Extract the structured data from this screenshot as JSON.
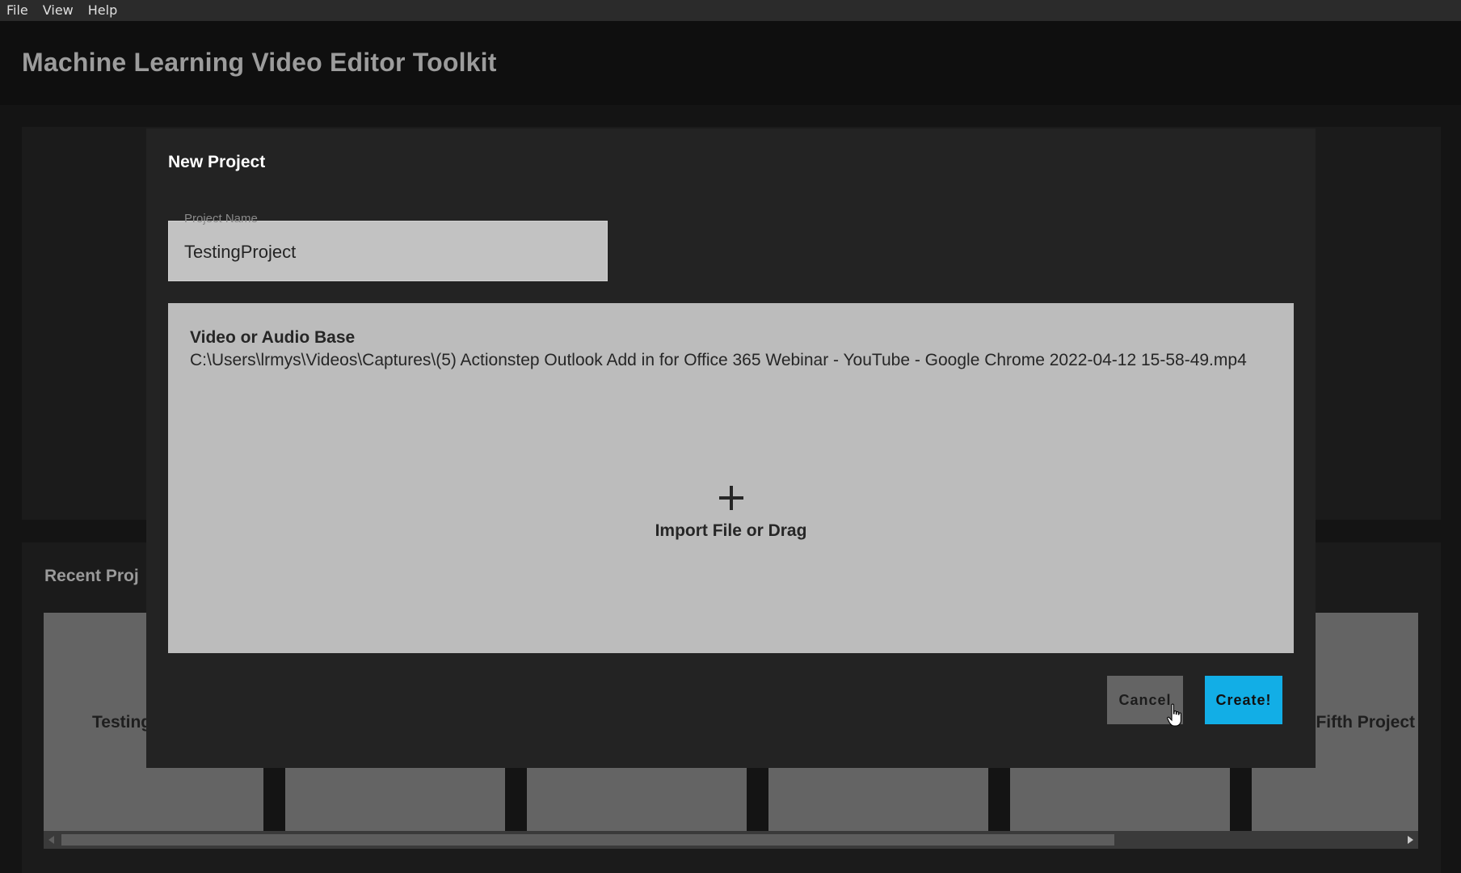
{
  "menubar": {
    "items": [
      "File",
      "View",
      "Help"
    ]
  },
  "header": {
    "title": "Machine Learning Video Editor Toolkit"
  },
  "recent_projects": {
    "title": "Recent Proj",
    "cards": [
      {
        "label": "Testing"
      },
      {
        "label": ""
      },
      {
        "label": ""
      },
      {
        "label": ""
      },
      {
        "label": ""
      },
      {
        "label": "Fifth Project"
      }
    ]
  },
  "modal": {
    "title": "New Project",
    "project_name_label": "Project Name",
    "project_name_value": "TestingProject",
    "dropzone_heading": "Video or Audio Base",
    "dropzone_path": "C:\\Users\\lrmys\\Videos\\Captures\\(5) Actionstep Outlook Add in for Office 365 Webinar - YouTube - Google Chrome 2022-04-12 15-58-49.mp4",
    "import_label": "Import File or Drag",
    "cancel_label": "Cancel",
    "create_label": "Create!"
  },
  "colors": {
    "accent": "#12aee6",
    "background": "#141414",
    "modal": "#232323"
  }
}
